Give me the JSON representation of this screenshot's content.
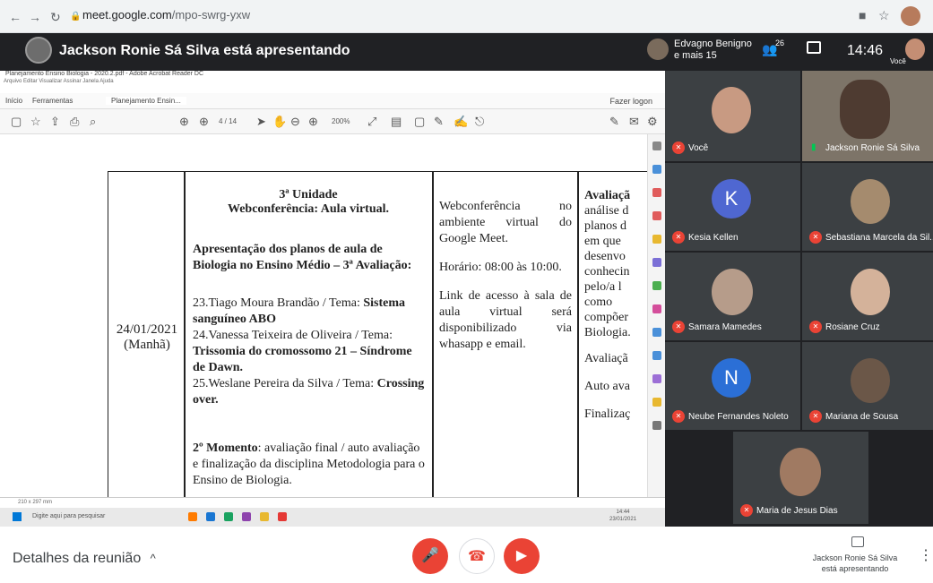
{
  "browser": {
    "url_host": "meet.google.com",
    "url_path": "/mpo-swrg-yxw"
  },
  "meet_header": {
    "presenter_title": "Jackson Ronie Sá Silva está apresentando",
    "participants_line1": "Edvagno Benigno",
    "participants_line2": "e mais 15",
    "people_count": "26",
    "time": "14:46",
    "self_label": "Você"
  },
  "acrobat": {
    "window_title": "Planejamento Ensino Biologia - 2020.2.pdf - Adobe Acrobat Reader DC",
    "menu": "Arquivo  Editar  Visualizar  Assinar  Janela  Ajuda",
    "tab_home": "Início",
    "tab_tools": "Ferramentas",
    "tab_doc": "Planejamento Ensin...",
    "login": "Fazer logon",
    "page_counter": "4 / 14",
    "zoom": "200%",
    "page_size": "210 x 297 mm"
  },
  "doc": {
    "date": "24/01/2021",
    "period": "(Manhã)",
    "unit": "3ª Unidade",
    "unit_sub": "Webconferência: Aula virtual.",
    "presentation_title": "Apresentação dos planos de aula de Biologia no Ensino Médio – 3ª Avaliação:",
    "item23_pre": "23.Tiago Moura Brandão / Tema: ",
    "item23_bold": "Sistema sanguíneo ABO",
    "item24_pre": "24.Vanessa Teixeira de Oliveira / Tema: ",
    "item24_bold": "Trissomia do cromossomo 21 – Síndrome de Dawn.",
    "item25_pre": "25.Weslane Pereira da Silva / Tema: ",
    "item25_bold": "Crossing over.",
    "moment_bold": "2º Momento",
    "moment_text": ": avaliação final / auto avaliação e finalização da disciplina Metodologia para o Ensino de Biologia.",
    "col3_a": "Webconferência no ambiente virtual do Google Meet.",
    "col3_b": "Horário: 08:00 às 10:00.",
    "col3_c": "Link de acesso à sala de aula virtual será disponibilizado via whasapp e email.",
    "col4_title": "Avaliaçã",
    "col4_lines": [
      "análise d",
      "planos d",
      "em que",
      "desenvo",
      "conhecin",
      "pelo/a l",
      "como",
      "compõer",
      "Biologia."
    ],
    "col4_b": "Avaliaçã",
    "col4_c": "Auto ava",
    "col4_d": "Finalizaç"
  },
  "taskbar": {
    "search": "Digite aqui para pesquisar",
    "tray_time": "14:44",
    "tray_date": "23/01/2021"
  },
  "tiles": [
    {
      "name": "Você"
    },
    {
      "name": "Jackson Ronie Sá Silva"
    },
    {
      "name": "Kesia Kellen",
      "letter": "K"
    },
    {
      "name": "Sebastiana Marcela da Sil..."
    },
    {
      "name": "Samara Mamedes"
    },
    {
      "name": "Rosiane Cruz"
    },
    {
      "name": "Neube Fernandes Noleto",
      "letter": "N"
    },
    {
      "name": "Mariana de Sousa"
    },
    {
      "name": "Maria de Jesus Dias"
    }
  ],
  "bottom": {
    "details": "Detalhes da reunião",
    "presenting_line1": "Jackson Ronie Sá Silva",
    "presenting_line2": "está apresentando"
  },
  "colors": {
    "meet_dark": "#202124",
    "tile_bg": "#3c4043",
    "red": "#ea4335",
    "k_avatar": "#4f67d1",
    "n_avatar": "#2b6fd6"
  }
}
